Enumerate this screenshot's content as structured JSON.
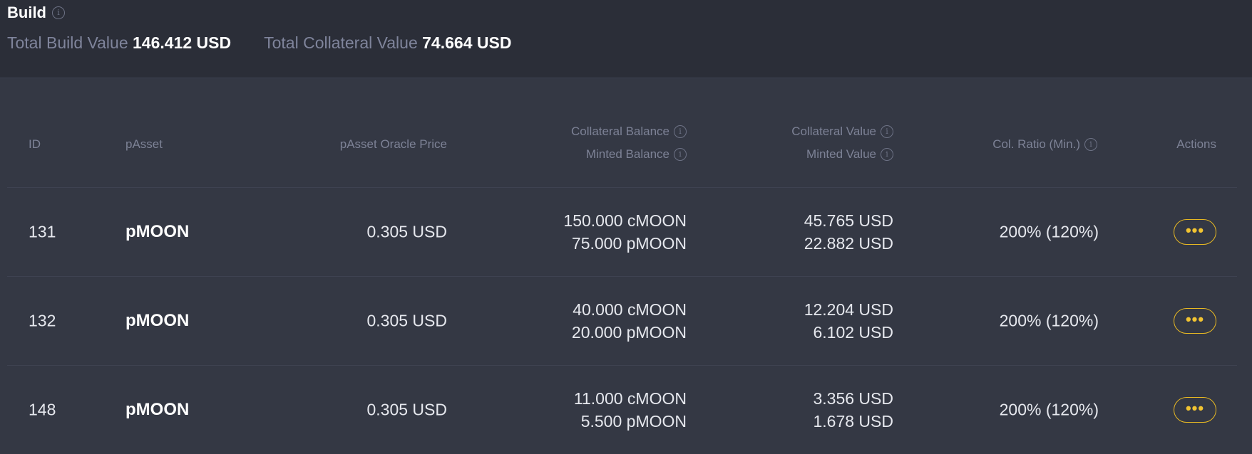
{
  "header": {
    "title": "Build",
    "total_build_label": "Total Build Value",
    "total_build_value": "146.412 USD",
    "total_collateral_label": "Total Collateral Value",
    "total_collateral_value": "74.664 USD"
  },
  "table": {
    "columns": {
      "id": "ID",
      "passet": "pAsset",
      "oracle_price": "pAsset Oracle Price",
      "collateral_balance": "Collateral Balance",
      "minted_balance": "Minted Balance",
      "collateral_value": "Collateral Value",
      "minted_value": "Minted Value",
      "col_ratio": "Col. Ratio (Min.)",
      "actions": "Actions"
    },
    "rows": [
      {
        "id": "131",
        "passet": "pMOON",
        "oracle_price": "0.305 USD",
        "collateral_balance": "150.000 cMOON",
        "minted_balance": "75.000 pMOON",
        "collateral_value": "45.765 USD",
        "minted_value": "22.882 USD",
        "col_ratio": "200% (120%)",
        "action_label": "•••"
      },
      {
        "id": "132",
        "passet": "pMOON",
        "oracle_price": "0.305 USD",
        "collateral_balance": "40.000 cMOON",
        "minted_balance": "20.000 pMOON",
        "collateral_value": "12.204 USD",
        "minted_value": "6.102 USD",
        "col_ratio": "200% (120%)",
        "action_label": "•••"
      },
      {
        "id": "148",
        "passet": "pMOON",
        "oracle_price": "0.305 USD",
        "collateral_balance": "11.000 cMOON",
        "minted_balance": "5.500 pMOON",
        "collateral_value": "3.356 USD",
        "minted_value": "1.678 USD",
        "col_ratio": "200% (120%)",
        "action_label": "•••"
      }
    ]
  },
  "icons": {
    "info": "info-icon",
    "more": "more-icon"
  },
  "colors": {
    "accent": "#e8b923",
    "header_bg": "#2b2e38",
    "table_bg": "#343844",
    "muted_text": "#7f849b"
  }
}
